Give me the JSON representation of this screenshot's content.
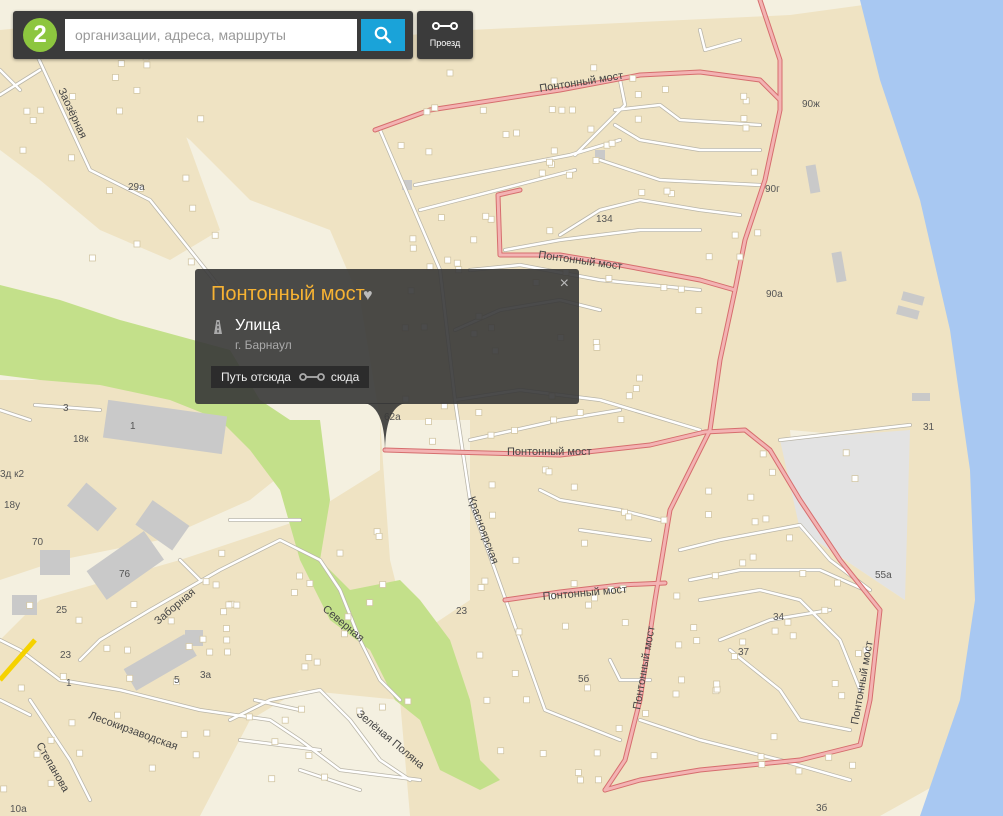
{
  "search": {
    "logo_text": "2",
    "placeholder": "организации, адреса, маршруты",
    "search_icon": "magnifier-icon",
    "route_label": "Проезд",
    "route_icon": "route-icon"
  },
  "popup": {
    "title": "Понтонный мост",
    "type": "Улица",
    "city": "г. Барнаул",
    "route_from": "Путь отсюда",
    "route_to": "сюда",
    "close": "×",
    "favorite_icon": "heart-icon",
    "type_icon": "road-icon"
  },
  "map": {
    "colors": {
      "background": "#f4f0e0",
      "residential": "#efe3c3",
      "water": "#a8c8f2",
      "park": "#c3e08a",
      "road_main_fill": "#f3b3b3",
      "road_main_edge": "#d66e6e",
      "road_local": "#ffffff",
      "building": "#ffffff",
      "industrial": "#c9c9c9"
    },
    "street_labels": [
      "Понтонный мост",
      "Понтонный мост",
      "Понтонный мост",
      "Понтонный мост",
      "Понтонный мост",
      "Понтонный мост",
      "Заозёрная",
      "Красноярская",
      "Заборная",
      "Северная",
      "Лесокирзаводская",
      "Зелёная Поляна",
      "Степанова"
    ],
    "house_numbers": [
      "90ж",
      "90г",
      "134",
      "90а",
      "31",
      "55а",
      "34",
      "37",
      "5б",
      "3б",
      "23",
      "29а",
      "3",
      "1",
      "18к",
      "3д к2",
      "18у",
      "70",
      "76",
      "25",
      "23",
      "5",
      "3а",
      "1",
      "10а",
      "62а"
    ]
  }
}
